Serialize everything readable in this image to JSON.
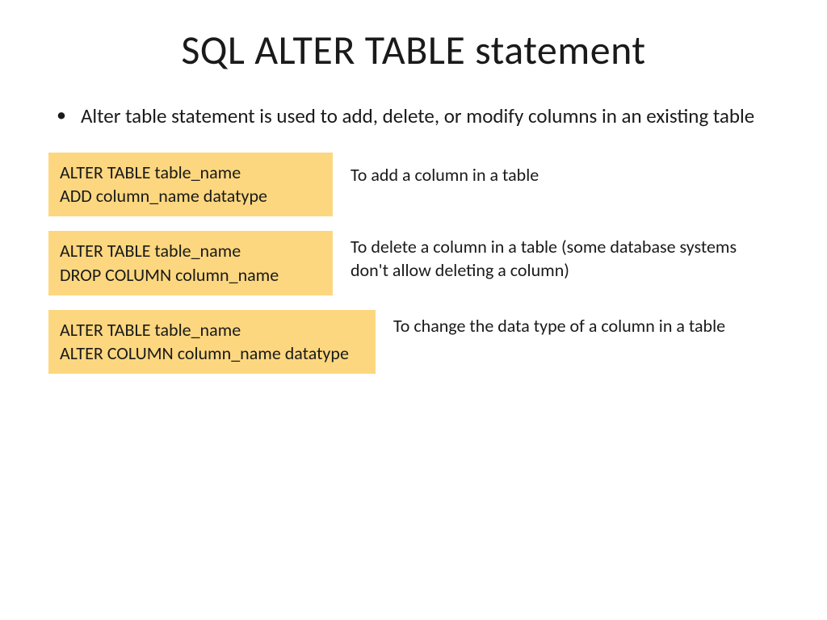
{
  "title": "SQL ALTER TABLE statement",
  "bullet": {
    "marker": "•",
    "text": "Alter table statement is used to add, delete, or modify columns in an existing table"
  },
  "examples": [
    {
      "code": "ALTER TABLE table_name\nADD column_name datatype",
      "desc": "To add a column in a table"
    },
    {
      "code": "ALTER TABLE table_name\nDROP COLUMN column_name",
      "desc": "To delete a column in a table (some database systems don't allow deleting a column)"
    },
    {
      "code": "ALTER TABLE table_name\nALTER COLUMN column_name datatype",
      "desc": "To change the data type of a column in a table"
    }
  ]
}
